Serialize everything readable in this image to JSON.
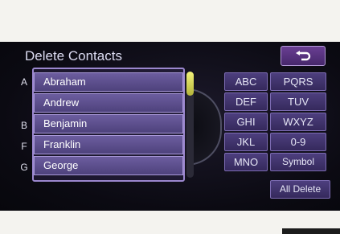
{
  "header": {
    "title": "Delete Contacts",
    "back_icon": "return-arrow-icon"
  },
  "index_letters": [
    "A",
    "B",
    "F",
    "G"
  ],
  "contacts": [
    "Abraham",
    "Andrew",
    "Benjamin",
    "Franklin",
    "George"
  ],
  "scroll": {
    "position_fraction": 0.0
  },
  "keyboard": {
    "keys": [
      "ABC",
      "PQRS",
      "DEF",
      "TUV",
      "GHI",
      "WXYZ",
      "JKL",
      "0-9",
      "MNO",
      "Symbol"
    ],
    "all_delete_label": "All Delete"
  },
  "colors": {
    "accent_purple": "#6a3f93",
    "row_purple": "#5e5090",
    "scroll_yellow": "#e2e262"
  }
}
